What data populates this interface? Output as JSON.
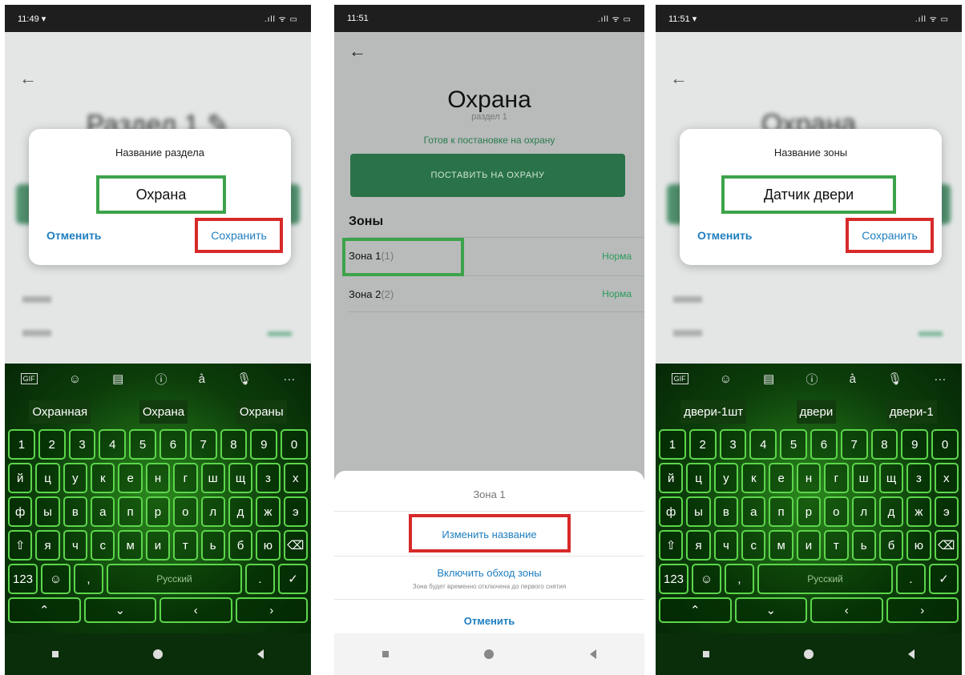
{
  "colors": {
    "accent_green": "#3ca34a",
    "accent_red": "#d72929",
    "link_blue": "#1e7ec0",
    "app_green": "#2a7249"
  },
  "phone1": {
    "time": "11:49 ▾",
    "signal": ".ıll ᯤ ▭",
    "blur_title": "Раздел 1 ✎",
    "dialog": {
      "title": "Название раздела",
      "value": "Охрана",
      "cancel": "Отменить",
      "save": "Сохранить"
    },
    "suggestions": [
      "Охранная",
      "Охрана",
      "Охраны"
    ]
  },
  "phone2": {
    "time": "11:51",
    "signal": ".ıll ᯤ ▭",
    "back": "←",
    "title": "Охрана",
    "subtitle": "раздел 1",
    "status": "Готов к постановке на охрану",
    "arm_button": "ПОСТАВИТЬ НА ОХРАНУ",
    "zones_header": "Зоны",
    "zones": [
      {
        "name": "Зона 1",
        "count": "(1)",
        "state": "Норма"
      },
      {
        "name": "Зона 2",
        "count": "(2)",
        "state": "Норма"
      }
    ],
    "sheet": {
      "title": "Зона 1",
      "rename": "Изменить название",
      "bypass": "Включить обход зоны",
      "bypass_note": "Зона будет временно отключена до первого снятия",
      "cancel": "Отменить"
    }
  },
  "phone3": {
    "time": "11:51 ▾",
    "signal": ".ıll ᯤ ▭",
    "blur_title": "Охрана",
    "dialog": {
      "title": "Название зоны",
      "value": "Датчик двери",
      "cancel": "Отменить",
      "save": "Сохранить"
    },
    "suggestions": [
      "двери-1шт",
      "двери",
      "двери-1"
    ]
  },
  "keyboard": {
    "toolbar": [
      "GIF",
      "☺",
      "▤",
      "ⓘ",
      "a͛",
      "🎙",
      "···"
    ],
    "digits": [
      "1",
      "2",
      "3",
      "4",
      "5",
      "6",
      "7",
      "8",
      "9",
      "0"
    ],
    "row1": [
      "й",
      "ц",
      "у",
      "к",
      "е",
      "н",
      "г",
      "ш",
      "щ",
      "з",
      "х"
    ],
    "row2": [
      "ф",
      "ы",
      "в",
      "а",
      "п",
      "р",
      "о",
      "л",
      "д",
      "ж",
      "э"
    ],
    "row3": [
      "я",
      "ч",
      "с",
      "м",
      "и",
      "т",
      "ь",
      "б",
      "ю"
    ],
    "shift": "⇧",
    "backspace": "⌫",
    "num_key": "123",
    "emoji": "☺",
    "comma": ",",
    "space": "Русский",
    "enter": "✓",
    "arrows": [
      "⌃",
      "⌄",
      "‹",
      "›"
    ]
  }
}
